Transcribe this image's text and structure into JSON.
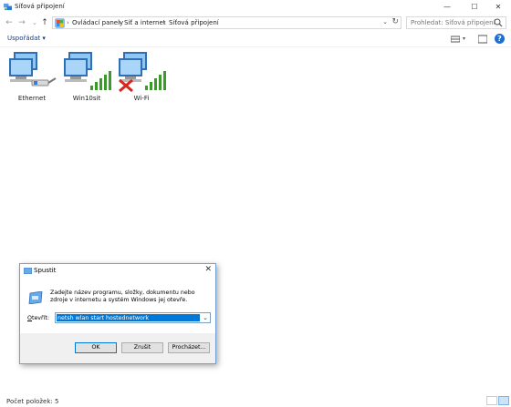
{
  "window": {
    "title": "Síťová připojení",
    "minimize": "—",
    "maximize": "☐",
    "close": "✕"
  },
  "nav": {
    "back": "←",
    "forward": "→",
    "recent": "⌄",
    "up": "↑",
    "breadcrumbs": [
      "Ovládací panely",
      "Síť a internet",
      "Síťová připojení"
    ],
    "separator": "›",
    "search_placeholder": "Prohledat: Síťová připojení"
  },
  "toolbar": {
    "organize_label": "Uspořádat",
    "organize_arrow": "▾",
    "help": "?"
  },
  "items": [
    {
      "label": "Ethernet",
      "icon": "ethernet-icon"
    },
    {
      "label": "Win10sit",
      "icon": "network-signal-icon"
    },
    {
      "label": "Wi-Fi",
      "icon": "wifi-disconnected-icon"
    }
  ],
  "status": {
    "count_label": "Počet položek: 5"
  },
  "run_dialog": {
    "title": "Spustit",
    "close": "✕",
    "description": "Zadejte název programu, složky, dokumentu nebo zdroje v internetu a systém Windows jej otevře.",
    "open_label": "Otevřít:",
    "command_value": "netsh wlan start hostednetwork",
    "ok_label": "OK",
    "cancel_label": "Zrušit",
    "browse_label": "Procházet..."
  },
  "colors": {
    "accent": "#0078d7",
    "selection": "#cce4f7",
    "signal_green": "#3a9a2a",
    "error_red": "#d9241c"
  }
}
